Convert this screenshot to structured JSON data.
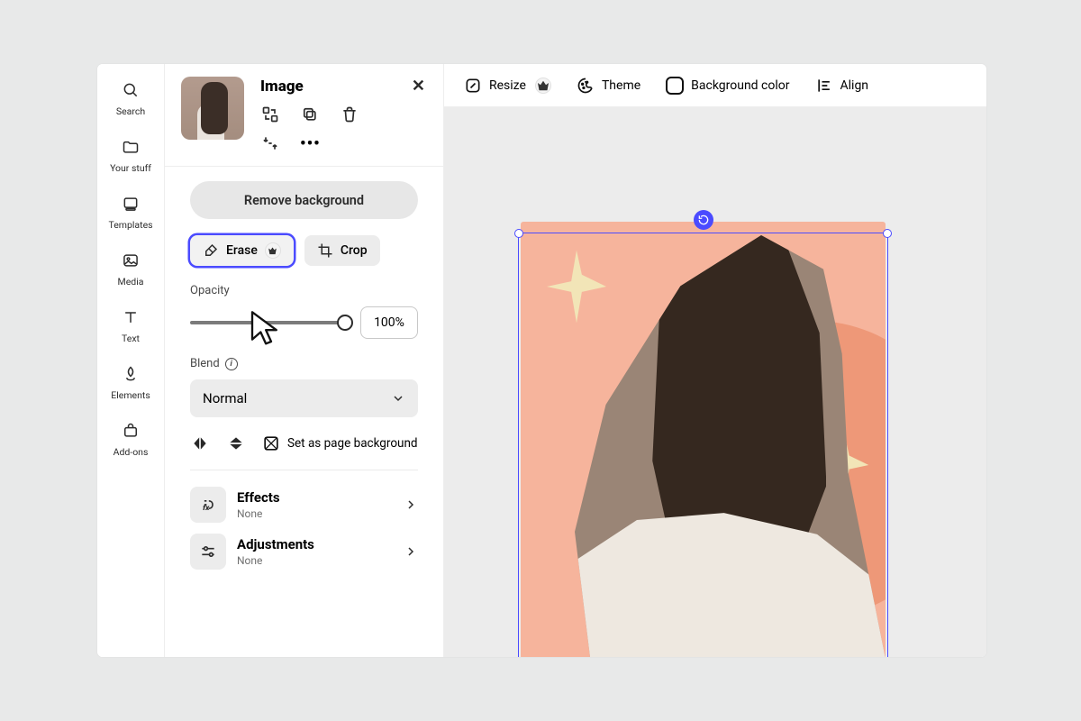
{
  "sidebar": {
    "items": [
      {
        "label": "Search"
      },
      {
        "label": "Your stuff"
      },
      {
        "label": "Templates"
      },
      {
        "label": "Media"
      },
      {
        "label": "Text"
      },
      {
        "label": "Elements"
      },
      {
        "label": "Add-ons"
      }
    ]
  },
  "inspector": {
    "title": "Image",
    "remove_bg": "Remove background",
    "erase_label": "Erase",
    "crop_label": "Crop",
    "opacity_label": "Opacity",
    "opacity_value": "100%",
    "opacity_percent": 100,
    "blend_label": "Blend",
    "blend_value": "Normal",
    "set_as_bg": "Set as page background",
    "effects": {
      "title": "Effects",
      "sub": "None"
    },
    "adjustments": {
      "title": "Adjustments",
      "sub": "None"
    }
  },
  "topbar": {
    "resize": "Resize",
    "theme": "Theme",
    "bgcolor": "Background color",
    "align": "Align"
  }
}
